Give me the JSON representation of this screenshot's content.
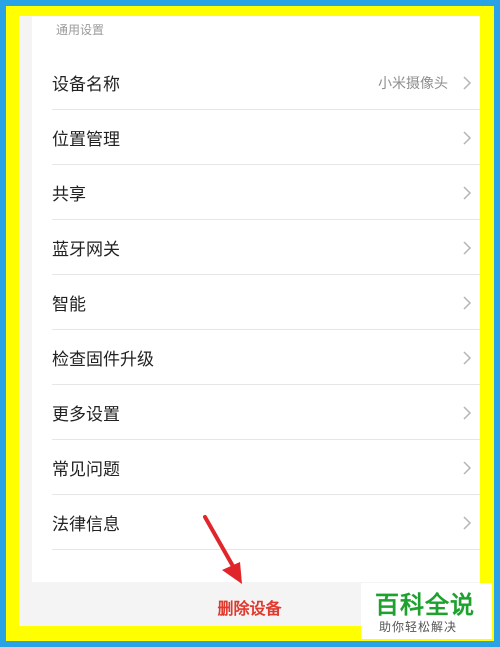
{
  "section_header": "通用设置",
  "rows": [
    {
      "label": "设备名称",
      "value": "小米摄像头"
    },
    {
      "label": "位置管理",
      "value": ""
    },
    {
      "label": "共享",
      "value": ""
    },
    {
      "label": "蓝牙网关",
      "value": ""
    },
    {
      "label": "智能",
      "value": ""
    },
    {
      "label": "检查固件升级",
      "value": ""
    },
    {
      "label": "更多设置",
      "value": ""
    },
    {
      "label": "常见问题",
      "value": ""
    },
    {
      "label": "法律信息",
      "value": ""
    }
  ],
  "delete_button_label": "删除设备",
  "watermark": {
    "title": "百科全说",
    "subtitle": "助你轻松解决"
  },
  "colors": {
    "frame_outer": "#29a3e6",
    "frame_inner": "#ffff00",
    "delete_red": "#e03a2e",
    "arrow_red": "#e0262a",
    "watermark_green": "#1fa12f"
  },
  "icons": {
    "row_chevron": "chevron-right-icon",
    "annotation": "red-arrow-icon"
  }
}
